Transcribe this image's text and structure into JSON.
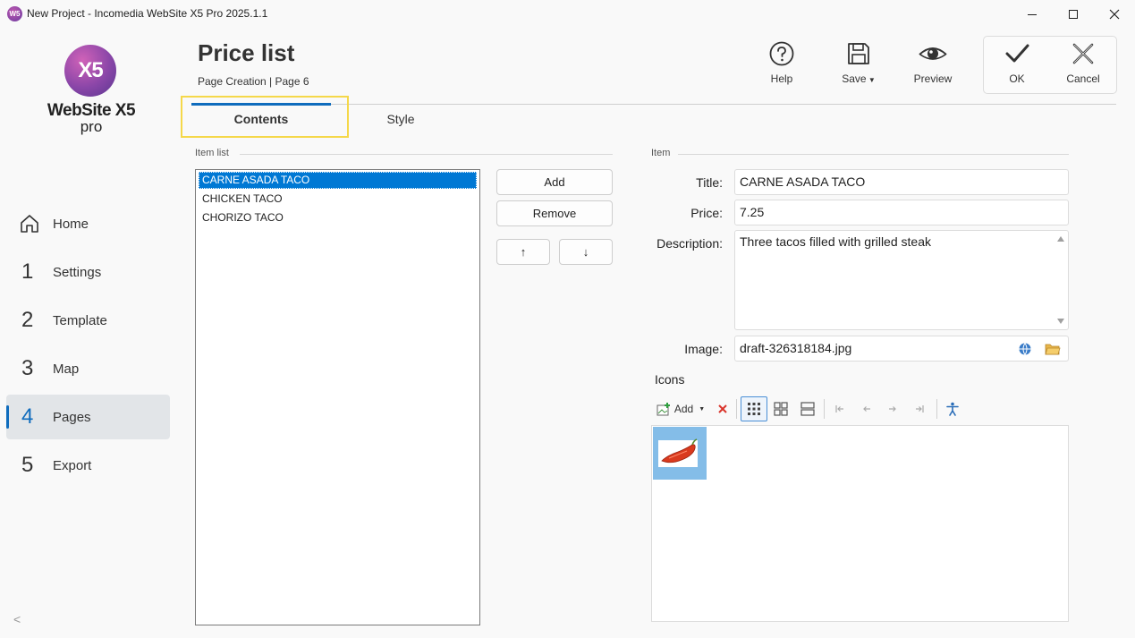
{
  "window": {
    "title": "New Project - Incomedia WebSite X5 Pro 2025.1.1",
    "app_icon_text": "W5"
  },
  "logo": {
    "mark": "X5",
    "name": "WebSite X5",
    "edition": "pro"
  },
  "sidebar": {
    "items": [
      {
        "num": "",
        "label": "Home",
        "icon": "home-icon"
      },
      {
        "num": "1",
        "label": "Settings"
      },
      {
        "num": "2",
        "label": "Template"
      },
      {
        "num": "3",
        "label": "Map"
      },
      {
        "num": "4",
        "label": "Pages",
        "active": true
      },
      {
        "num": "5",
        "label": "Export"
      }
    ],
    "collapse": "<"
  },
  "header": {
    "title": "Price list",
    "subtitle": "Page Creation | Page 6"
  },
  "toolbar": {
    "help": "Help",
    "save": "Save",
    "preview": "Preview",
    "ok": "OK",
    "cancel": "Cancel"
  },
  "tabs": {
    "contents": "Contents",
    "style": "Style",
    "active": "Contents"
  },
  "item_list": {
    "group_label": "Item list",
    "items": [
      "CARNE ASADA TACO",
      "CHICKEN TACO",
      "CHORIZO TACO"
    ],
    "selected": "CARNE ASADA TACO",
    "add": "Add",
    "remove": "Remove",
    "up": "↑",
    "down": "↓"
  },
  "item": {
    "group_label": "Item",
    "title_label": "Title:",
    "title_value": "CARNE ASADA TACO",
    "price_label": "Price:",
    "price_value": "7.25",
    "description_label": "Description:",
    "description_value": "Three tacos filled with grilled steak",
    "image_label": "Image:",
    "image_value": "draft-326318184.jpg"
  },
  "icons": {
    "label": "Icons",
    "add": "Add",
    "items": [
      {
        "name": "chili-pepper-icon"
      }
    ]
  },
  "colors": {
    "accent": "#0f6cbd",
    "selection": "#0078d4",
    "highlight": "#f5d84a",
    "thumb_bg": "#84bde8"
  }
}
